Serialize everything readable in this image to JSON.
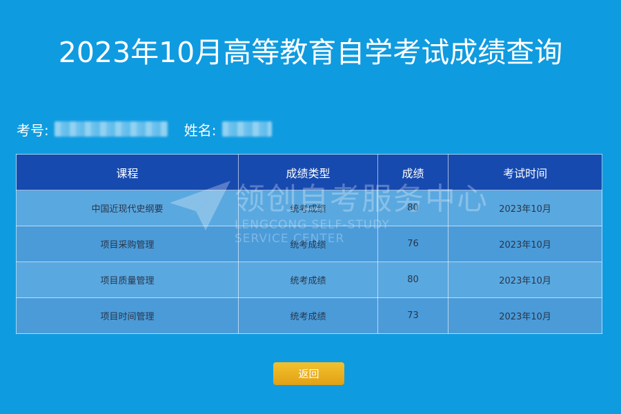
{
  "page": {
    "title": "2023年10月高等教育自学考试成绩查询"
  },
  "student": {
    "id_label": "考号:",
    "name_label": "姓名:"
  },
  "table": {
    "headers": [
      "课程",
      "成绩类型",
      "成绩",
      "考试时间"
    ],
    "rows": [
      {
        "course": "中国近现代史纲要",
        "type": "统考成绩",
        "score": "80",
        "time": "2023年10月"
      },
      {
        "course": "项目采购管理",
        "type": "统考成绩",
        "score": "76",
        "time": "2023年10月"
      },
      {
        "course": "项目质量管理",
        "type": "统考成绩",
        "score": "80",
        "time": "2023年10月"
      },
      {
        "course": "项目时间管理",
        "type": "统考成绩",
        "score": "73",
        "time": "2023年10月"
      }
    ]
  },
  "watermark": {
    "main": "领创自考服务中心",
    "sub_line1": "LENGCONG SELF-STUDY",
    "sub_line2": "SERVICE CENTER",
    "icon": "paper-plane-icon"
  },
  "actions": {
    "back_label": "返回"
  },
  "colors": {
    "background": "#0f9be0",
    "header_row": "#174aaf",
    "row_light": "#5aa8e0",
    "row_dark": "#4b9bd9",
    "button": "#e9b022"
  }
}
